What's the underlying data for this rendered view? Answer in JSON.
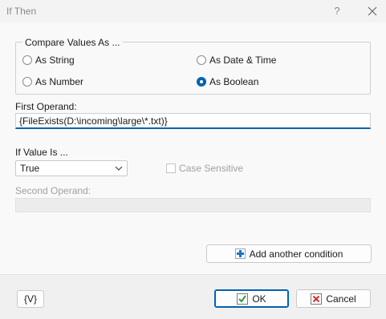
{
  "window": {
    "title": "If Then",
    "help_label": "?"
  },
  "compare": {
    "legend": "Compare Values  As ...",
    "options": [
      {
        "label": "As String",
        "checked": false
      },
      {
        "label": "As Date & Time",
        "checked": false
      },
      {
        "label": "As Number",
        "checked": false
      },
      {
        "label": "As Boolean",
        "checked": true
      }
    ]
  },
  "first_operand": {
    "label": "First Operand:",
    "value": "{FileExists(D:\\incoming\\large\\*.txt)}"
  },
  "if_value": {
    "label": "If Value Is ...",
    "selected": "True"
  },
  "case_sensitive": {
    "label": "Case Sensitive",
    "checked": false
  },
  "second_operand": {
    "label": "Second Operand:",
    "value": ""
  },
  "add_condition": {
    "label": "Add another condition"
  },
  "footer": {
    "var_label": "{V}",
    "ok_label": "OK",
    "cancel_label": "Cancel"
  },
  "colors": {
    "accent": "#0063b1",
    "plus_blue": "#1e73be",
    "ok_green": "#2e9b3a",
    "cancel_red": "#d32f2f"
  }
}
